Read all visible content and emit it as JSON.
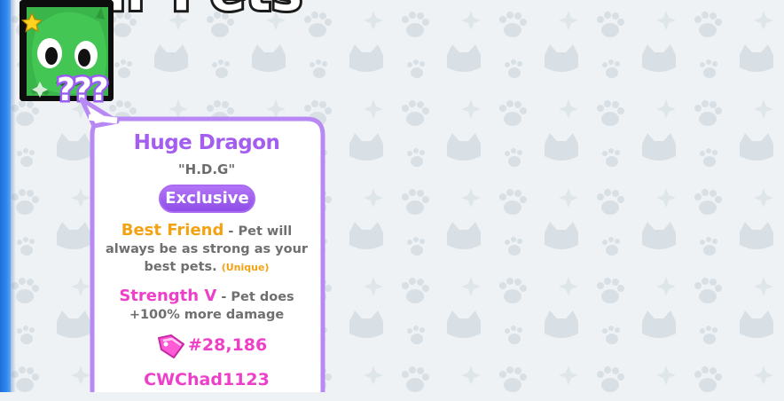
{
  "screen": {
    "title_text": "Your Pets"
  },
  "pet_slot": {
    "hidden_marker": "???",
    "icon": "green-dragon-pet-icon",
    "star_icon": "gold-star-icon"
  },
  "tooltip": {
    "pet_name": "Huge Dragon",
    "pet_tag": "\"H.D.G\"",
    "rarity": "Exclusive",
    "enchants": [
      {
        "name": "Best Friend",
        "description": " - Pet will always be as strong as your best pets. ",
        "note": "(Unique)"
      },
      {
        "name": "Strength V",
        "description": " - Pet does +100% more damage",
        "note": ""
      }
    ],
    "exist_icon": "pink-tag-icon",
    "exist_count": "#28,186",
    "owner": "CWChad1123"
  },
  "colors": {
    "accent_purple": "#a35ef0",
    "enchant_gold": "#f2a213",
    "enchant_pink": "#ee3fc9",
    "background": "#eef2f4",
    "left_bar_blue": "#2f86ee"
  }
}
